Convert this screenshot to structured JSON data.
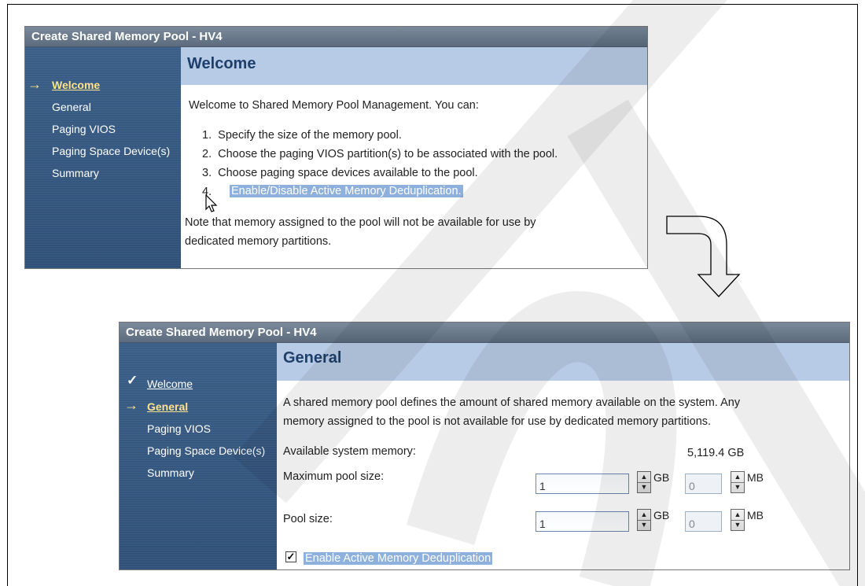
{
  "welcome_panel": {
    "title": "Create Shared Memory Pool - HV4",
    "nav": [
      "Welcome",
      "General",
      "Paging VIOS",
      "Paging Space Device(s)",
      "Summary"
    ],
    "header": "Welcome",
    "intro": "Welcome to Shared Memory Pool Management. You can:",
    "steps": [
      "1.  Specify the size of the memory pool.",
      "2.  Choose the paging VIOS partition(s) to be associated with the pool.",
      "3.  Choose paging space devices available to the pool.",
      "4."
    ],
    "step4_text": "Enable/Disable Active Memory Deduplication.",
    "note_line1": "Note that memory assigned to the pool will not be available for use by",
    "note_line2": "dedicated memory partitions."
  },
  "general_panel": {
    "title": "Create Shared Memory Pool - HV4",
    "nav": [
      "Welcome",
      "General",
      "Paging VIOS",
      "Paging Space Device(s)",
      "Summary"
    ],
    "header": "General",
    "desc_line1": "A shared memory pool defines the amount of shared memory available on the system. Any",
    "desc_line2": "memory assigned to the pool is not available for use by dedicated memory partitions.",
    "available_label": "Available system memory:",
    "available_value": "5,119.4 GB",
    "max_pool_label": "Maximum pool size:",
    "max_pool_gb": "1",
    "max_pool_mb": "0",
    "pool_size_label": "Pool size:",
    "pool_size_gb": "1",
    "pool_size_mb": "0",
    "unit_gb": "GB",
    "unit_mb": "MB",
    "dedup_label": "Enable Active Memory Deduplication",
    "dedup_checked": true
  },
  "colors": {
    "title_bar": "#6a7b8e",
    "nav_bg": "#345882",
    "header_bg": "#b8cbe6",
    "current_link": "#ffe38a",
    "selection": "#8eb0dc"
  },
  "icons": {
    "current_step": "arrow-right-icon",
    "completed_step": "checkmark-icon",
    "flow": "curved-arrow-icon",
    "pointer": "mouse-cursor-icon"
  }
}
